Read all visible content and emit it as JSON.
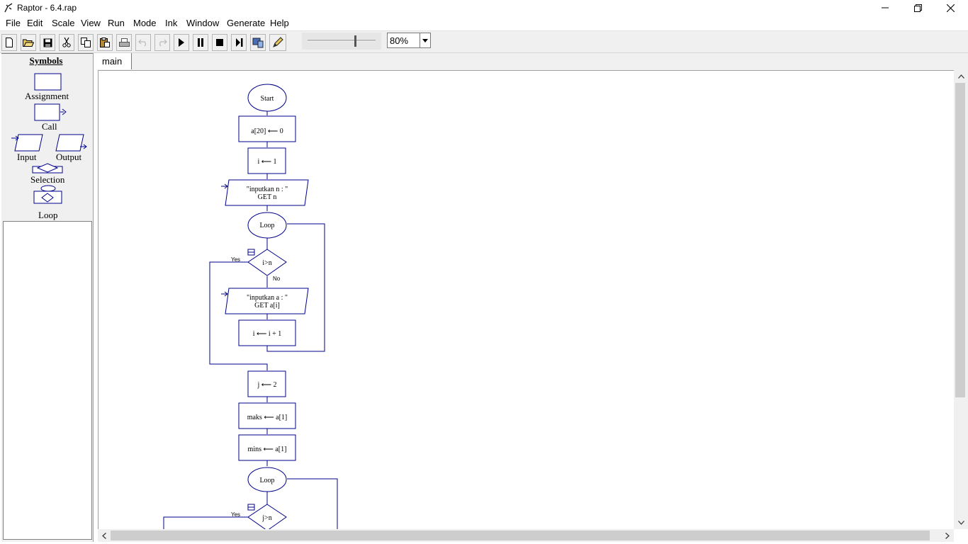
{
  "window": {
    "title": "Raptor - 6.4.rap",
    "icons": [
      "raptor-app-icon",
      "minimize-icon",
      "restore-icon",
      "close-icon"
    ]
  },
  "menu": {
    "items": [
      "File",
      "Edit",
      "Scale",
      "View",
      "Run",
      "Mode",
      "Ink",
      "Window",
      "Generate",
      "Help"
    ]
  },
  "toolbar": {
    "buttons": [
      "new-file-icon",
      "open-folder-icon",
      "save-icon",
      "cut-icon",
      "copy-icon",
      "paste-icon",
      "print-icon",
      "undo-icon",
      "redo-icon",
      "play-icon",
      "pause-icon",
      "stop-icon",
      "step-icon",
      "test-server-icon",
      "pen-icon"
    ],
    "zoom_value": "80%"
  },
  "symbols": {
    "title": "Symbols",
    "assignment": "Assignment",
    "call": "Call",
    "input": "Input",
    "output": "Output",
    "selection": "Selection",
    "loop": "Loop"
  },
  "tabs": [
    "main"
  ],
  "flowchart": {
    "start": "Start",
    "assign1": "a[20] ⟵ 0",
    "assign2": "i ⟵ 1",
    "input1_prompt": "\"inputkan n : \"",
    "input1_get": "GET n",
    "loop1": "Loop",
    "decision1": "i>n",
    "yes1": "Yes",
    "no1": "No",
    "input2_prompt": "\"inputkan a : \"",
    "input2_get": "GET a[i]",
    "assign3": "i ⟵ i + 1",
    "assign4": "j ⟵ 2",
    "assign5": "maks ⟵ a[1]",
    "assign6": "mins ⟵ a[1]",
    "loop2": "Loop",
    "decision2": "j>n",
    "yes2": "Yes"
  },
  "colors": {
    "flow_stroke": "#00008b",
    "window_bg": "#f0f0f0",
    "canvas_bg": "#ffffff"
  }
}
